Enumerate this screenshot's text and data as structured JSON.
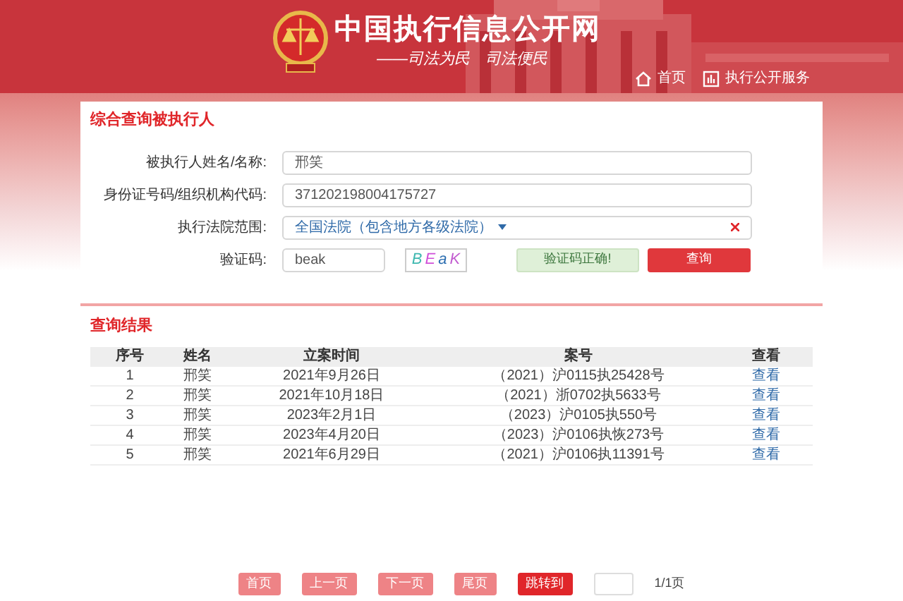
{
  "header": {
    "title": "中国执行信息公开网",
    "slogan": "——司法为民　司法便民",
    "nav": [
      {
        "kind": "home",
        "label": "首页"
      },
      {
        "kind": "service",
        "label": "执行公开服务"
      }
    ]
  },
  "search": {
    "title": "综合查询被执行人",
    "fields": [
      {
        "kind": "text",
        "label": "被执行人姓名/名称:",
        "value": "邢笑"
      },
      {
        "kind": "text",
        "label": "身份证号码/组织机构代码:",
        "value": "371202198004175727"
      },
      {
        "kind": "select",
        "label": "执行法院范围:",
        "value": "全国法院（包含地方各级法院）"
      }
    ],
    "captcha": {
      "label": "验证码:",
      "value": "beak",
      "letters": [
        {
          "text": "B",
          "color": "#3fb8b0"
        },
        {
          "text": "E",
          "color": "#d04fd8"
        },
        {
          "text": "a",
          "color": "#2a6db0"
        },
        {
          "text": "K",
          "color": "#c25cd0"
        }
      ],
      "status": "验证码正确!"
    },
    "submit": "查询"
  },
  "results": {
    "title": "查询结果",
    "columns": [
      "序号",
      "姓名",
      "立案时间",
      "案号",
      "查看"
    ],
    "rows": [
      {
        "no": "1",
        "name": "邢笑",
        "date": "2021年9月26日",
        "case": "（2021）沪0115执25428号",
        "link": "查看"
      },
      {
        "no": "2",
        "name": "邢笑",
        "date": "2021年10月18日",
        "case": "（2021）浙0702执5633号",
        "link": "查看"
      },
      {
        "no": "3",
        "name": "邢笑",
        "date": "2023年2月1日",
        "case": "（2023）沪0105执550号",
        "link": "查看"
      },
      {
        "no": "4",
        "name": "邢笑",
        "date": "2023年4月20日",
        "case": "（2023）沪0106执恢273号",
        "link": "查看"
      },
      {
        "no": "5",
        "name": "邢笑",
        "date": "2021年6月29日",
        "case": "（2021）沪0106执11391号",
        "link": "查看"
      }
    ]
  },
  "pagination": {
    "buttons": [
      {
        "label": "首页",
        "primary": false
      },
      {
        "label": "上一页",
        "primary": false
      },
      {
        "label": "下一页",
        "primary": false
      },
      {
        "label": "尾页",
        "primary": false
      },
      {
        "label": "跳转到",
        "primary": true
      }
    ],
    "page_info": "1/1页"
  }
}
